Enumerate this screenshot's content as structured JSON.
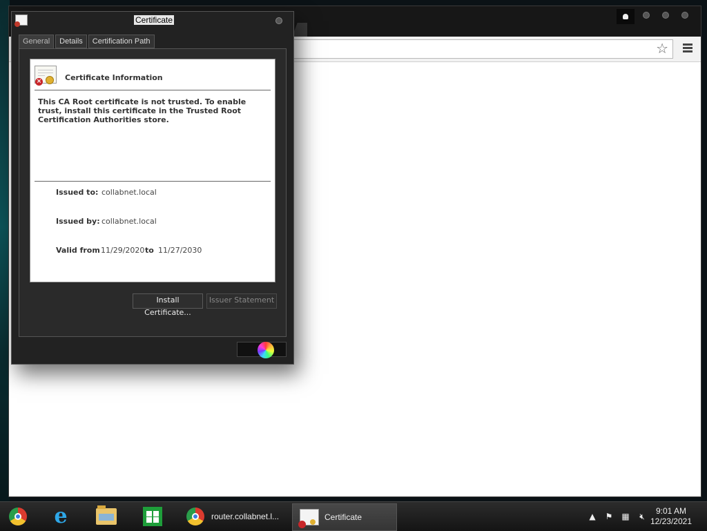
{
  "dialog": {
    "title": "Certificate",
    "tabs": [
      {
        "label": "General"
      },
      {
        "label": "Details"
      },
      {
        "label": "Certification Path"
      }
    ],
    "info_heading": "Certificate Information",
    "message": "This CA Root certificate is not trusted. To enable trust, install this certificate in the Trusted Root Certification Authorities store.",
    "issued_to_label": "Issued to:",
    "issued_to": "collabnet.local",
    "issued_by_label": "Issued by:",
    "issued_by": "collabnet.local",
    "valid_from_label": "Valid from",
    "valid_from": "11/29/2020",
    "to_label": "to",
    "valid_to": "11/27/2030",
    "install_button": "Install Certificate...",
    "issuer_statement_button": "Issuer Statement"
  },
  "taskbar": {
    "items": [
      {
        "label": "router.collabnet.l...",
        "icon": "chrome-icon"
      },
      {
        "label": "Certificate",
        "icon": "certificate-icon"
      }
    ],
    "clock": {
      "time": "9:01 AM",
      "date": "12/23/2021"
    }
  }
}
